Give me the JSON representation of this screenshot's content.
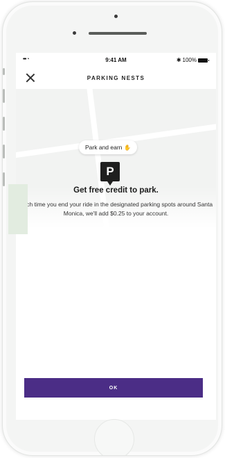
{
  "status_bar": {
    "signal": "••• ◔",
    "time": "9:41 AM",
    "bluetooth": "✱",
    "battery": "100%"
  },
  "nav": {
    "title": "PARKING NESTS"
  },
  "map": {
    "tooltip": "Park and earn",
    "tooltip_icon": "✋",
    "pin_label": "P"
  },
  "content": {
    "headline": "Get free credit to park.",
    "body": "Each time you end your ride in the designated parking spots around Santa Monica, we'll add $0.25 to your account."
  },
  "actions": {
    "ok_label": "OK"
  },
  "colors": {
    "accent": "#4b2d86",
    "pin": "#1f1f1f",
    "hand": "#e7a02a"
  }
}
